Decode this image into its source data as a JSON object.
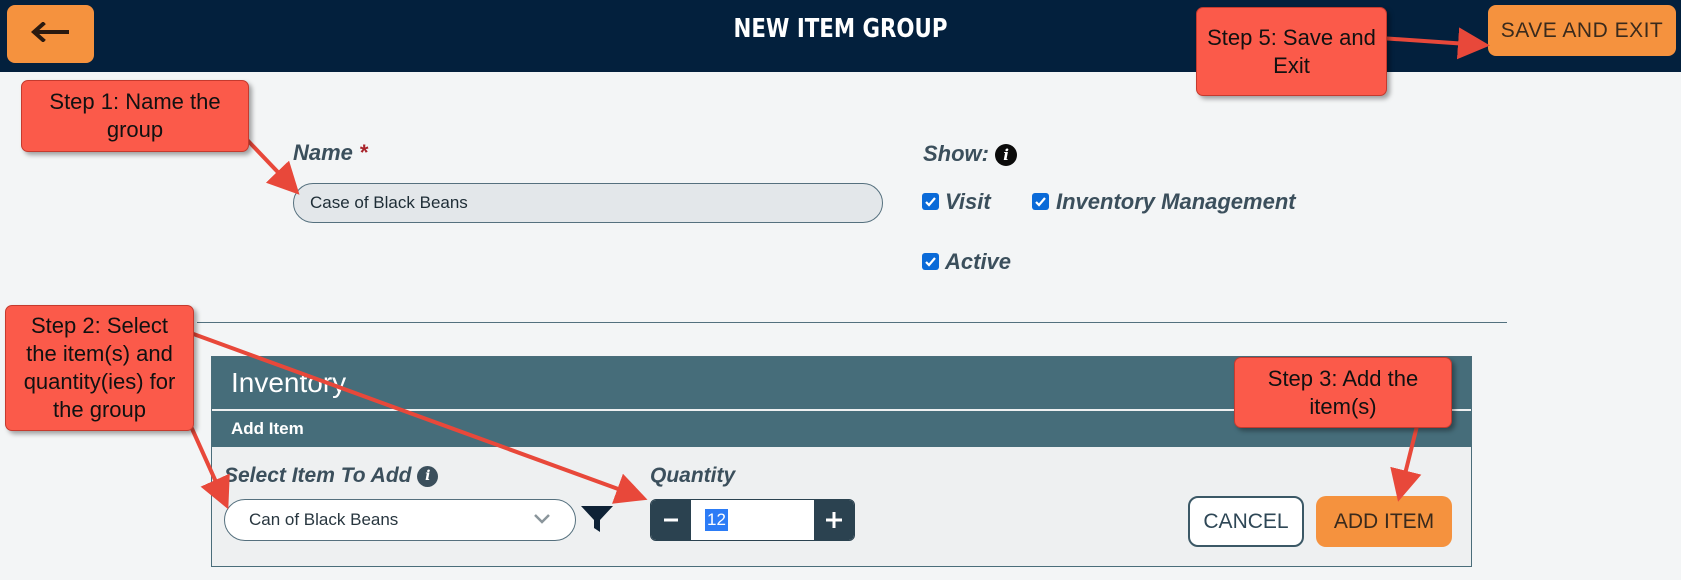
{
  "header": {
    "title": "NEW ITEM GROUP",
    "back_icon": "arrow-left-icon",
    "save_label": "SAVE AND EXIT"
  },
  "form": {
    "name_label": "Name",
    "name_required_marker": "*",
    "name_value": "Case of Black Beans",
    "show_label": "Show:",
    "show_info_icon": "info-icon",
    "checkboxes": [
      {
        "label": "Visit",
        "checked": true
      },
      {
        "label": "Inventory Management",
        "checked": true
      },
      {
        "label": "Active",
        "checked": true
      }
    ]
  },
  "inventory": {
    "title": "Inventory",
    "subheader": "Add Item",
    "select_label": "Select Item To Add",
    "select_value": "Can of Black Beans",
    "quantity_label": "Quantity",
    "quantity_value": "12",
    "cancel_label": "CANCEL",
    "add_label": "ADD ITEM"
  },
  "callouts": {
    "step1": "Step 1: Name the group",
    "step2": "Step 2: Select the item(s) and quantity(ies) for the group",
    "step3": "Step 3: Add the item(s)",
    "step5": "Step 5: Save and Exit"
  },
  "colors": {
    "header_bg": "#03203d",
    "accent_orange": "#f5923e",
    "panel_bg": "#466d7a",
    "callout_red": "#fb5a4a",
    "checkbox_blue": "#0a6ad8"
  }
}
